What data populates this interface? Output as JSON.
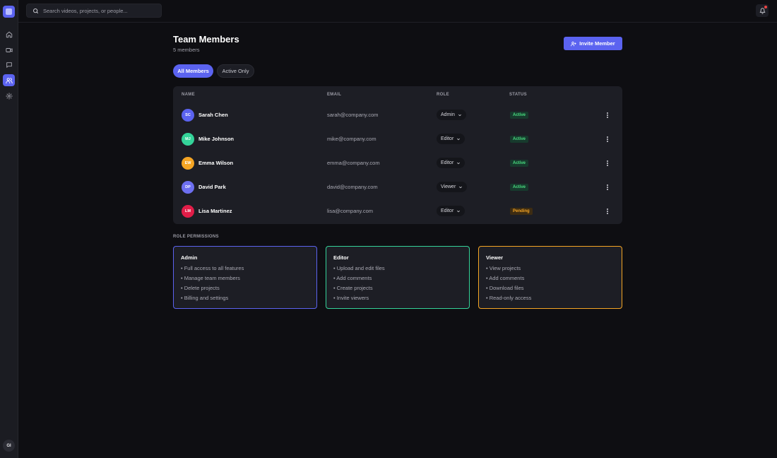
{
  "app": {
    "user_initials": "GI",
    "accent_color": "#5b63f0"
  },
  "sidebar": {
    "items": [
      {
        "icon": "home-icon"
      },
      {
        "icon": "video-icon"
      },
      {
        "icon": "message-icon"
      },
      {
        "icon": "users-icon",
        "active": true
      },
      {
        "icon": "gear-icon"
      }
    ]
  },
  "search": {
    "placeholder": "Search videos, projects, or people...",
    "value": ""
  },
  "header": {
    "title": "Team Members",
    "subtitle": "5 members",
    "invite_label": "Invite Member"
  },
  "filters": {
    "all_label": "All Members",
    "active_label": "Active Only",
    "selected": "All Members"
  },
  "table": {
    "columns": [
      "NAME",
      "EMAIL",
      "ROLE",
      "STATUS"
    ],
    "rows": [
      {
        "initials": "SC",
        "name": "Sarah Chen",
        "email": "sarah@company.com",
        "role": "Admin",
        "status": "Active",
        "avatar_color": "#5b63f0"
      },
      {
        "initials": "MJ",
        "name": "Mike Johnson",
        "email": "mike@company.com",
        "role": "Editor",
        "status": "Active",
        "avatar_color": "#34d399"
      },
      {
        "initials": "EW",
        "name": "Emma Wilson",
        "email": "emma@company.com",
        "role": "Editor",
        "status": "Active",
        "avatar_color": "#f5a524"
      },
      {
        "initials": "DP",
        "name": "David Park",
        "email": "david@company.com",
        "role": "Viewer",
        "status": "Active",
        "avatar_color": "#6d6ff0"
      },
      {
        "initials": "LM",
        "name": "Lisa Martinez",
        "email": "lisa@company.com",
        "role": "Editor",
        "status": "Pending",
        "avatar_color": "#e11d48"
      }
    ]
  },
  "permissions": {
    "label": "ROLE PERMISSIONS",
    "cards": [
      {
        "title": "Admin",
        "color": "#5b63f0",
        "items": [
          "• Full access to all features",
          "• Manage team members",
          "• Delete projects",
          "• Billing and settings"
        ]
      },
      {
        "title": "Editor",
        "color": "#34d399",
        "items": [
          "• Upload and edit files",
          "• Add comments",
          "• Create projects",
          "• Invite viewers"
        ]
      },
      {
        "title": "Viewer",
        "color": "#f5a524",
        "items": [
          "• View projects",
          "• Add comments",
          "• Download files",
          "• Read-only access"
        ]
      }
    ]
  }
}
